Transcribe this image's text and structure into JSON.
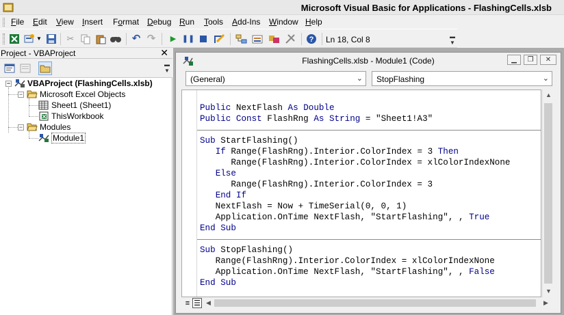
{
  "window": {
    "title": "Microsoft Visual Basic for Applications - FlashingCells.xlsb"
  },
  "menu": [
    {
      "label": "File",
      "mnemonic_index": 0
    },
    {
      "label": "Edit",
      "mnemonic_index": 0
    },
    {
      "label": "View",
      "mnemonic_index": 0
    },
    {
      "label": "Insert",
      "mnemonic_index": 0
    },
    {
      "label": "Format",
      "mnemonic_index": 1
    },
    {
      "label": "Debug",
      "mnemonic_index": 0
    },
    {
      "label": "Run",
      "mnemonic_index": 0
    },
    {
      "label": "Tools",
      "mnemonic_index": 0
    },
    {
      "label": "Add-Ins",
      "mnemonic_index": 0
    },
    {
      "label": "Window",
      "mnemonic_index": 0
    },
    {
      "label": "Help",
      "mnemonic_index": 0
    }
  ],
  "toolbar": {
    "status": "Ln 18, Col 8",
    "icons": [
      "view-excel-icon",
      "insert-module-icon",
      "save-icon",
      "cut-icon",
      "copy-icon",
      "paste-icon",
      "find-icon",
      "undo-icon",
      "redo-icon",
      "run-icon",
      "break-icon",
      "reset-icon",
      "design-mode-icon",
      "project-explorer-icon",
      "properties-icon",
      "object-browser-icon",
      "toolbox-icon",
      "help-icon"
    ]
  },
  "project": {
    "title": "Project - VBAProject",
    "close": "✕",
    "tree": [
      {
        "label": "VBAProject (FlashingCells.xlsb)",
        "level": 0,
        "icon": "vba-project-icon",
        "toggle": "−",
        "bold": true
      },
      {
        "label": "Microsoft Excel Objects",
        "level": 1,
        "icon": "folder-open-icon",
        "toggle": "−"
      },
      {
        "label": "Sheet1 (Sheet1)",
        "level": 2,
        "icon": "worksheet-icon"
      },
      {
        "label": "ThisWorkbook",
        "level": 2,
        "icon": "workbook-icon"
      },
      {
        "label": "Modules",
        "level": 1,
        "icon": "folder-open-icon",
        "toggle": "−"
      },
      {
        "label": "Module1",
        "level": 2,
        "icon": "module-icon",
        "selected": true
      }
    ]
  },
  "code_window": {
    "title": "FlashingCells.xlsb - Module1 (Code)",
    "object_combo": "(General)",
    "procedure_combo": "StopFlashing",
    "lines": [
      {
        "text": ""
      },
      {
        "text": "Public NextFlash As Double",
        "kw": [
          "Public",
          "As",
          "Double"
        ]
      },
      {
        "text": "Public Const FlashRng As String = \"Sheet1!A3\"",
        "kw": [
          "Public",
          "Const",
          "As",
          "String"
        ]
      },
      {
        "text": "",
        "divider": true
      },
      {
        "text": "Sub StartFlashing()",
        "kw": [
          "Sub"
        ]
      },
      {
        "text": "   If Range(FlashRng).Interior.ColorIndex = 3 Then",
        "kw": [
          "If",
          "Then"
        ]
      },
      {
        "text": "      Range(FlashRng).Interior.ColorIndex = xlColorIndexNone"
      },
      {
        "text": "   Else",
        "kw": [
          "Else"
        ]
      },
      {
        "text": "      Range(FlashRng).Interior.ColorIndex = 3"
      },
      {
        "text": "   End If",
        "kw": [
          "End",
          "If"
        ]
      },
      {
        "text": "   NextFlash = Now + TimeSerial(0, 0, 1)"
      },
      {
        "text": "   Application.OnTime NextFlash, \"StartFlashing\", , True",
        "kw": [
          "True"
        ]
      },
      {
        "text": "End Sub",
        "kw": [
          "End",
          "Sub"
        ]
      },
      {
        "text": "",
        "divider": true
      },
      {
        "text": "Sub StopFlashing()",
        "kw": [
          "Sub"
        ]
      },
      {
        "text": "   Range(FlashRng).Interior.ColorIndex = xlColorIndexNone"
      },
      {
        "text": "   Application.OnTime NextFlash, \"StartFlashing\", , False",
        "kw": [
          "False"
        ]
      },
      {
        "text": "End Sub",
        "kw": [
          "End",
          "Sub"
        ]
      }
    ]
  },
  "colors": {
    "keyword": "#00008b",
    "mdi_background": "#ababab"
  }
}
